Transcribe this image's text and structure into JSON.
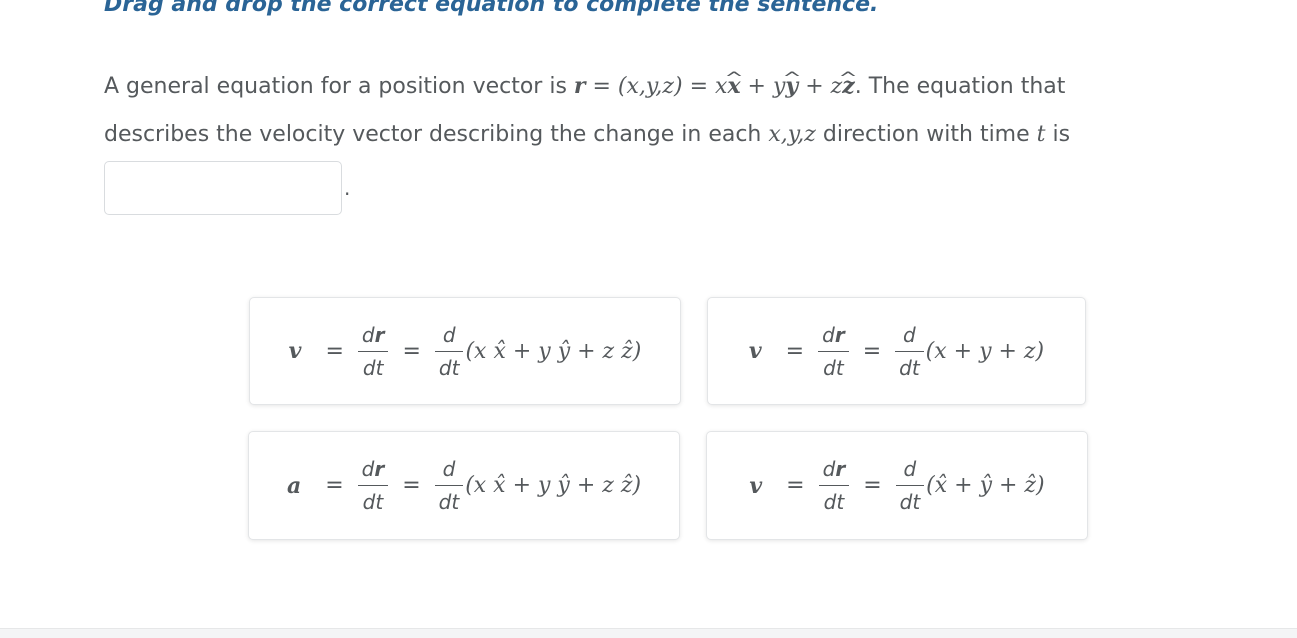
{
  "instruction": "Drag and drop the correct equation to complete the sentence.",
  "sentence": {
    "part1": "A general equation for a position vector is ",
    "r_sym": "r",
    "eq1": " = ",
    "tuple": "(x,y,z)",
    "eq2": " = ",
    "expr_x": "x",
    "hat_x": "x",
    "plus1": " + ",
    "expr_y": "y",
    "hat_y": "y",
    "plus2": " + ",
    "expr_z": "z",
    "hat_z": "z",
    "part2": ". The equation that",
    "line2a": "describes the velocity vector describing the change in each ",
    "xyz": "x,y,z",
    "line2b": " direction with time ",
    "t_sym": "t",
    "line2c": " is",
    "period": "."
  },
  "dropzone": {
    "value": ""
  },
  "options": [
    {
      "lhs": "v",
      "eq": "=",
      "frac1_num": "dr",
      "frac1_den": "dt",
      "eq2": "=",
      "frac2_num": "d",
      "frac2_den": "dt",
      "tail": "(x x̂ + y ŷ + z ẑ)"
    },
    {
      "lhs": "v",
      "eq": "=",
      "frac1_num": "dr",
      "frac1_den": "dt",
      "eq2": "=",
      "frac2_num": "d",
      "frac2_den": "dt",
      "tail": "(x + y + z)"
    },
    {
      "lhs": "a",
      "eq": "=",
      "frac1_num": "dr",
      "frac1_den": "dt",
      "eq2": "=",
      "frac2_num": "d",
      "frac2_den": "dt",
      "tail": "(x x̂ + y ŷ + z ẑ)"
    },
    {
      "lhs": "v",
      "eq": "=",
      "frac1_num": "dr",
      "frac1_den": "dt",
      "eq2": "=",
      "frac2_num": "d",
      "frac2_den": "dt",
      "tail": "(x̂ + ŷ + ẑ)"
    }
  ],
  "colors": {
    "title": "#2a6496",
    "text": "#55595c",
    "card_border": "#e3e5e7"
  }
}
